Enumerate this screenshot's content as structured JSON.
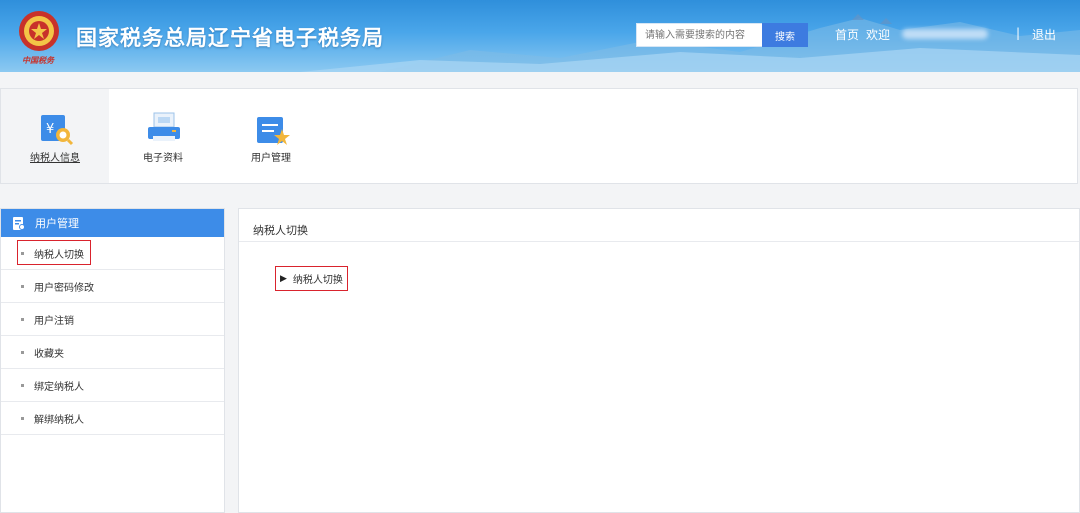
{
  "header": {
    "site_title": "国家税务总局辽宁省电子税务局",
    "search_placeholder": "请输入需要搜索的内容",
    "search_button": "搜索",
    "home_link": "首页",
    "welcome": "欢迎",
    "divider": "|",
    "logout": "退出",
    "emblem_text": "中国税务"
  },
  "topnav": {
    "items": [
      {
        "label": "纳税人信息",
        "icon": "taxpayer-info-icon",
        "active": true
      },
      {
        "label": "电子资料",
        "icon": "printer-icon",
        "active": false
      },
      {
        "label": "用户管理",
        "icon": "user-management-icon",
        "active": false
      }
    ]
  },
  "sidebar": {
    "heading": "用户管理",
    "items": [
      {
        "label": "纳税人切换",
        "highlight": true
      },
      {
        "label": "用户密码修改"
      },
      {
        "label": "用户注销"
      },
      {
        "label": "收藏夹"
      },
      {
        "label": "绑定纳税人"
      },
      {
        "label": "解绑纳税人"
      }
    ]
  },
  "main": {
    "title": "纳税人切换",
    "link_label": "纳税人切换"
  },
  "colors": {
    "accent": "#3d8ce8",
    "highlight_border": "#d9232d",
    "header_top": "#2f8fdb"
  }
}
